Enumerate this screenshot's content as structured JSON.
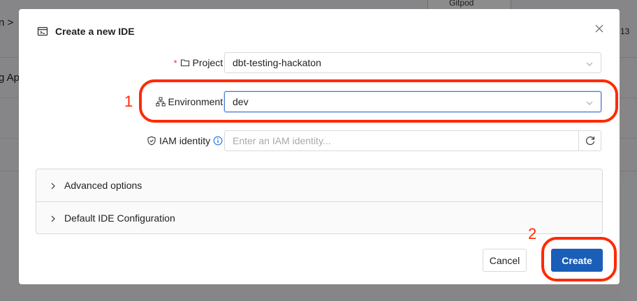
{
  "background": {
    "left_fragment_1": "n >",
    "left_fragment_2": "g Ap",
    "right_fragment": "13",
    "tab_label": "Gitpod"
  },
  "modal": {
    "title": "Create a new IDE",
    "fields": {
      "project": {
        "label": "Project",
        "required_mark": "*",
        "colon": ":",
        "value": "dbt-testing-hackaton"
      },
      "environment": {
        "label": "Environment",
        "colon": ":",
        "value": "dev"
      },
      "iam_identity": {
        "label": "IAM identity",
        "colon": ":",
        "placeholder": "Enter an IAM identity..."
      }
    },
    "panels": {
      "advanced": "Advanced options",
      "default_config": "Default IDE Configuration"
    },
    "buttons": {
      "cancel": "Cancel",
      "create": "Create"
    }
  },
  "annotations": {
    "num_1": "1",
    "num_2": "2",
    "color": "#ff2a00"
  },
  "colors": {
    "primary": "#1a5eb8",
    "info_icon": "#1a73e8"
  },
  "icons": [
    "modal-window-icon",
    "close-icon",
    "folder-icon",
    "hierarchy-icon",
    "shield-icon",
    "info-icon",
    "chevron-down-icon",
    "refresh-icon",
    "chevron-right-icon"
  ]
}
